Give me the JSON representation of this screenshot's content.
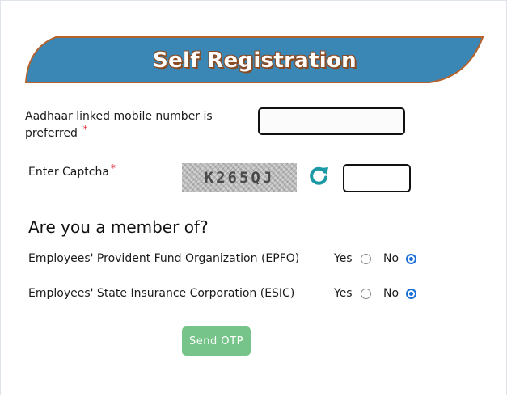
{
  "header": {
    "title": "Self Registration"
  },
  "mobile": {
    "label_line1": "Aadhaar linked mobile number is",
    "label_line2": "preferred",
    "required_mark": "*",
    "value": "",
    "placeholder": ""
  },
  "captcha": {
    "label": "Enter Captcha",
    "required_mark": "*",
    "code": "K265QJ",
    "refresh_icon": "refresh-icon",
    "value": ""
  },
  "membership": {
    "title": "Are you a member of?",
    "questions": [
      {
        "label": "Employees' Provident Fund Organization (EPFO)",
        "yes_label": "Yes",
        "no_label": "No",
        "selected": "No"
      },
      {
        "label": "Employees' State Insurance Corporation (ESIC)",
        "yes_label": "Yes",
        "no_label": "No",
        "selected": "No"
      }
    ]
  },
  "actions": {
    "send_otp_label": "Send OTP"
  },
  "colors": {
    "banner": "#3a86b4",
    "banner_border": "#b5632d",
    "radio_selected": "#1a6fd6",
    "button": "#76c489",
    "required": "#e0242c",
    "refresh": "#1b9aa6"
  }
}
